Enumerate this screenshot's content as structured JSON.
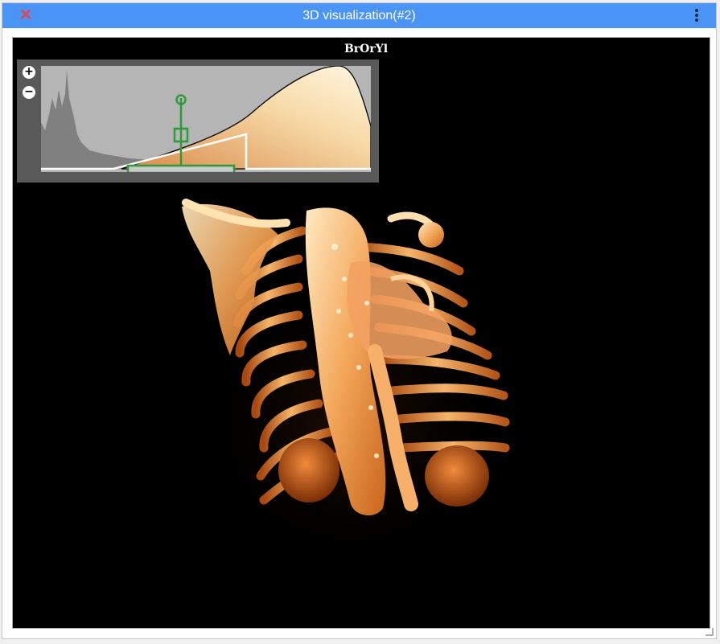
{
  "window": {
    "title": "3D visualization(#2)",
    "close_icon": "close-icon",
    "menu_icon": "vertical-dots-icon",
    "accent_color": "#4a94f5",
    "close_color": "#e0455a"
  },
  "viewport": {
    "colormap_label": "BrOrYl",
    "background": "#000000"
  },
  "transfer_function_editor": {
    "zoom_in_label": "+",
    "zoom_out_label": "−",
    "zoom_in_icon": "zoom-in-icon",
    "zoom_out_icon": "zoom-out-icon",
    "control_color": "#2f9a3a"
  },
  "render": {
    "subject": "volume-rendered chest CT (rib cage, spine, aorta, kidneys)",
    "colors": [
      "#7a2d05",
      "#c8651c",
      "#f3a75a",
      "#ffe9c2"
    ]
  }
}
